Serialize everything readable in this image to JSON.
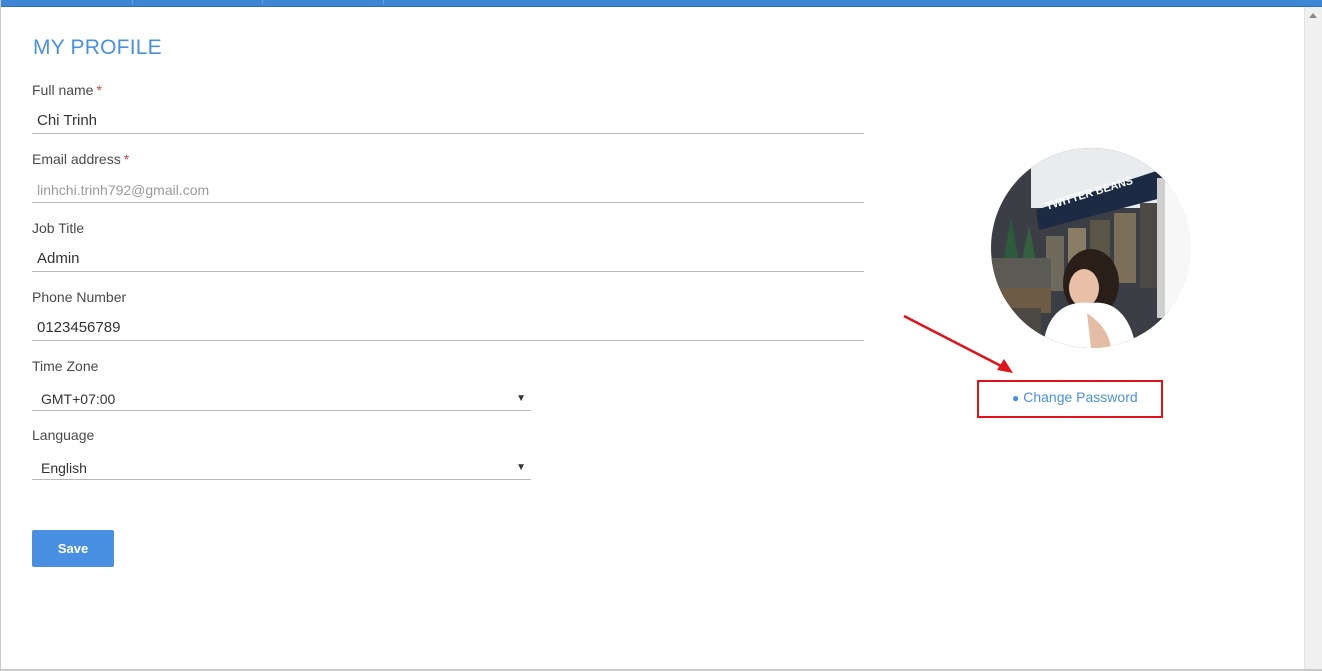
{
  "page": {
    "title": "MY PROFILE"
  },
  "form": {
    "full_name": {
      "label": "Full name",
      "required_mark": "*",
      "value": "Chi Trinh"
    },
    "email": {
      "label": "Email address",
      "required_mark": "*",
      "value": "linhchi.trinh792@gmail.com"
    },
    "job_title": {
      "label": "Job Title",
      "value": "Admin"
    },
    "phone": {
      "label": "Phone Number",
      "value": "0123456789"
    },
    "time_zone": {
      "label": "Time Zone",
      "value": "GMT+07:00"
    },
    "language": {
      "label": "Language",
      "value": "English"
    },
    "save_label": "Save"
  },
  "profile": {
    "change_password_label": "Change Password",
    "storefront_sign_text": "TWITTER BEANS"
  },
  "colors": {
    "accent": "#4a90e2",
    "required": "#d0434a",
    "annotation": "#e0131a"
  }
}
